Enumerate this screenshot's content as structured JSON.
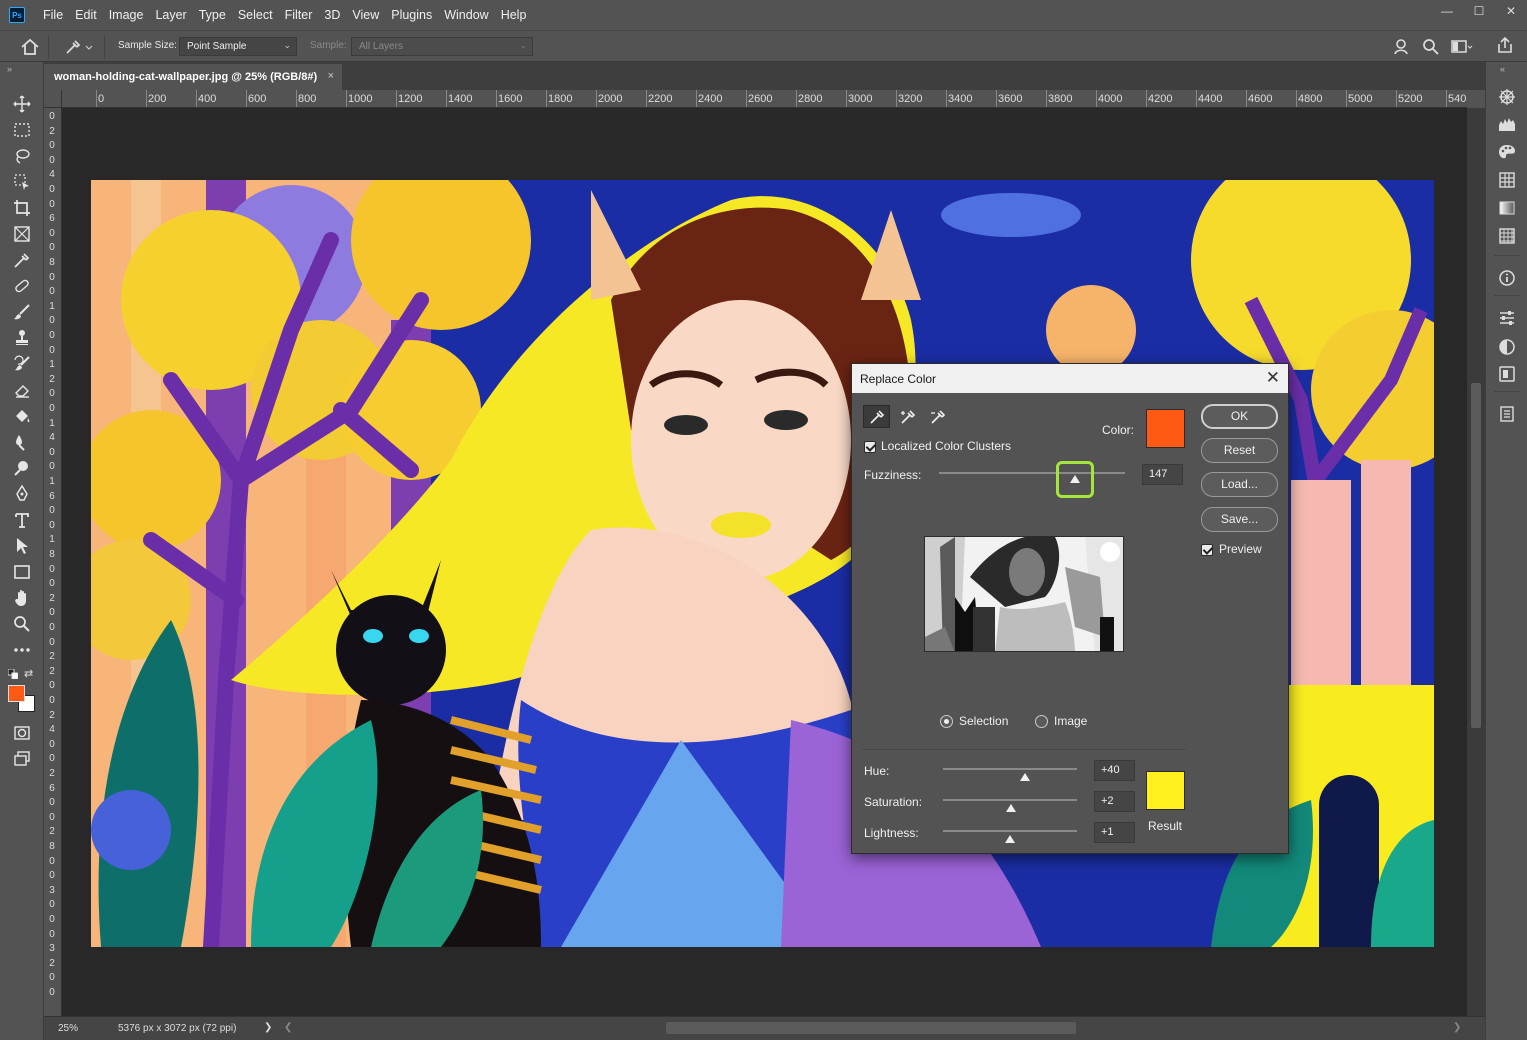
{
  "app": {
    "logo": "Ps",
    "menu": [
      "File",
      "Edit",
      "Image",
      "Layer",
      "Type",
      "Select",
      "Filter",
      "3D",
      "View",
      "Plugins",
      "Window",
      "Help"
    ],
    "window_controls": [
      "—",
      "☐",
      "✕"
    ]
  },
  "options_bar": {
    "sample_size_label": "Sample Size:",
    "sample_size_value": "Point Sample",
    "sample_label": "Sample:",
    "sample_value": "All Layers"
  },
  "document": {
    "tab_title": "woman-holding-cat-wallpaper.jpg @ 25% (RGB/8#)",
    "close": "×"
  },
  "rulers": {
    "horizontal": [
      "0",
      "200",
      "400",
      "600",
      "800",
      "1000",
      "1200",
      "1400",
      "1600",
      "1800",
      "2000",
      "2200",
      "2400",
      "2600",
      "2800",
      "3000",
      "3200",
      "3400",
      "3600",
      "3800",
      "4000",
      "4200",
      "4400",
      "4600",
      "4800",
      "5000",
      "5200",
      "540"
    ],
    "vertical": [
      "0",
      "2",
      "0",
      "0",
      "4",
      "0",
      "0",
      "6",
      "0",
      "0",
      "8",
      "0",
      "0",
      "1",
      "0",
      "0",
      "0",
      "1",
      "2",
      "0",
      "0",
      "1",
      "4",
      "0",
      "0",
      "1",
      "6",
      "0",
      "0",
      "1",
      "8",
      "0",
      "0",
      "2",
      "0",
      "0",
      "0",
      "2",
      "2",
      "0",
      "0",
      "2",
      "4",
      "0",
      "0",
      "2",
      "6",
      "0",
      "0",
      "2",
      "8",
      "0",
      "0",
      "3",
      "0",
      "0",
      "0",
      "3",
      "2",
      "0",
      "0"
    ]
  },
  "status_bar": {
    "zoom": "25%",
    "doc_info": "5376 px x 3072 px (72 ppi)",
    "arrow": "❯",
    "left_arrow": "❮",
    "right_arrow": "❯"
  },
  "dialog": {
    "title": "Replace Color",
    "close": "✕",
    "localized_label": "Localized Color Clusters",
    "localized_checked": true,
    "color_label": "Color:",
    "color_value": "#ff5a14",
    "fuzziness_label": "Fuzziness:",
    "fuzziness_value": "147",
    "fuzziness_fraction": 0.73,
    "selection_label": "Selection",
    "image_label": "Image",
    "view_mode": "selection",
    "hue_label": "Hue:",
    "hue_value": "+40",
    "hue_fraction": 0.61,
    "saturation_label": "Saturation:",
    "saturation_value": "+2",
    "saturation_fraction": 0.51,
    "lightness_label": "Lightness:",
    "lightness_value": "+1",
    "lightness_fraction": 0.5,
    "result_label": "Result",
    "result_color": "#fff01e",
    "buttons": {
      "ok": "OK",
      "reset": "Reset",
      "load": "Load...",
      "save": "Save..."
    },
    "preview_label": "Preview",
    "preview_checked": true,
    "highlight_color": "#a6e63c"
  },
  "foreground_color": "#ff5a14",
  "background_color": "#ffffff"
}
